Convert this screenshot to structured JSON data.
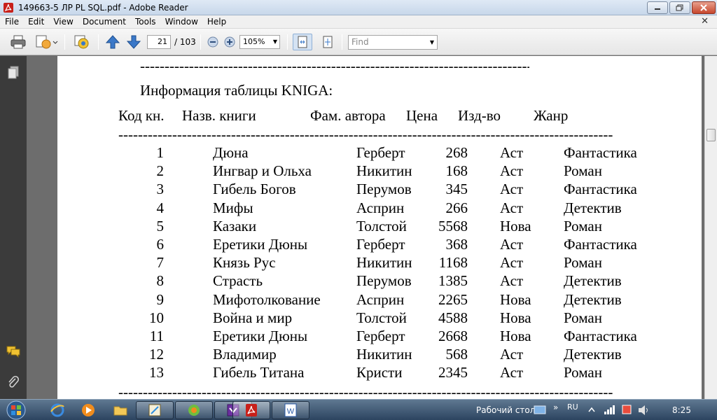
{
  "window": {
    "title": "149663-5 ЛР PL SQL.pdf - Adobe Reader"
  },
  "menu": {
    "items": [
      "File",
      "Edit",
      "View",
      "Document",
      "Tools",
      "Window",
      "Help"
    ]
  },
  "toolbar": {
    "page_current": "21",
    "page_total": "/ 103",
    "zoom": "105%",
    "find_placeholder": "Find"
  },
  "document": {
    "top_rule": "--------------------------------------------------------------------------------",
    "caption": "Информация таблицы KNIGA:",
    "headers": [
      "Код кн.",
      "Назв. книги",
      "Фам. автора",
      "Цена",
      "Изд-во",
      "Жанр"
    ],
    "mid_rule": "---------------------------------------------------------------------------------------------------------",
    "rows": [
      [
        "1",
        "Дюна",
        "Герберт",
        "268",
        "Аст",
        "Фантастика"
      ],
      [
        "2",
        "Ингвар и Ольха",
        "Никитин",
        "168",
        "Аст",
        "Роман"
      ],
      [
        "3",
        "Гибель Богов",
        "Перумов",
        "345",
        "Аст",
        "Фантастика"
      ],
      [
        "4",
        "Мифы",
        "Асприн",
        "266",
        "Аст",
        "Детектив"
      ],
      [
        "5",
        "Казаки",
        "Толстой",
        "5568",
        "Нова",
        "Роман"
      ],
      [
        "6",
        "Еретики Дюны",
        "Герберт",
        "368",
        "Аст",
        "Фантастика"
      ],
      [
        "7",
        "Князь Рус",
        "Никитин",
        "1168",
        "Аст",
        "Роман"
      ],
      [
        "8",
        "Страсть",
        "Перумов",
        "1385",
        "Аст",
        "Детектив"
      ],
      [
        "9",
        "Мифотолкование",
        "Асприн",
        "2265",
        "Нова",
        "Детектив"
      ],
      [
        "10",
        "Война и мир",
        "Толстой",
        "4588",
        "Нова",
        "Роман"
      ],
      [
        "11",
        "Еретики Дюны",
        "Герберт",
        "2668",
        "Нова",
        "Фантастика"
      ],
      [
        "12",
        "Владимир",
        "Никитин",
        "568",
        "Аст",
        "Детектив"
      ],
      [
        "13",
        "Гибель Титана",
        "Кристи",
        "2345",
        "Аст",
        "Роман"
      ]
    ],
    "bottom_rule": "---------------------------------------------------------------------------------------------------------"
  },
  "taskbar": {
    "desktop_label": "Рабочий стол",
    "lang": "RU",
    "clock": "8:25",
    "overflow": "»"
  },
  "icons": {
    "app": "adobe-reader-icon",
    "print": "printer-icon",
    "share": "share-icon",
    "review": "comment-review-icon",
    "prev": "arrow-up-icon",
    "next": "arrow-down-icon",
    "zoom_out": "zoom-out-icon",
    "zoom_in": "zoom-in-icon",
    "fit_page": "fit-page-icon",
    "fit_width": "fit-width-icon"
  },
  "colors": {
    "accent_blue": "#3a78c8",
    "reader_red": "#c8201a",
    "taskbar": "#2c4460"
  }
}
